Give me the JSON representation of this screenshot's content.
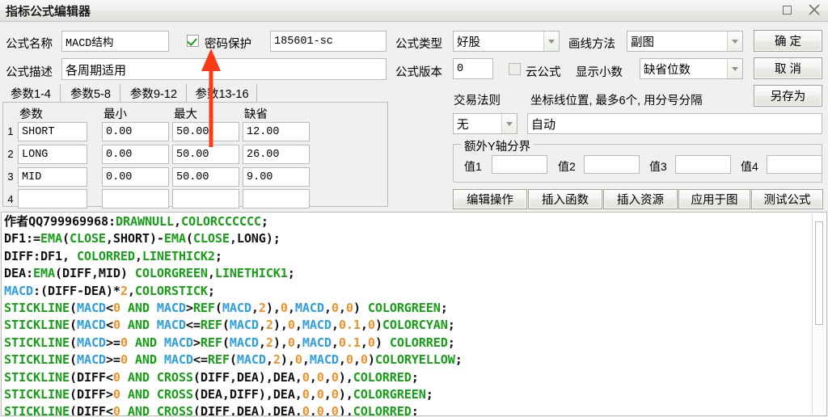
{
  "window": {
    "title": "指标公式编辑器",
    "maximize_icon": "maximize-icon",
    "close_icon": "close-icon"
  },
  "form": {
    "name_label": "公式名称",
    "name_value": "MACD结构",
    "password_protect_label": "密码保护",
    "password_protect_checked": true,
    "password_value": "185601-sc",
    "desc_label": "公式描述",
    "desc_value": "各周期适用",
    "type_label": "公式类型",
    "type_value": "好股",
    "draw_method_label": "画线方法",
    "draw_method_value": "副图",
    "version_label": "公式版本",
    "version_value": "0",
    "cloud_label": "云公式",
    "cloud_checked": false,
    "decimals_label": "显示小数",
    "decimals_value": "缺省位数"
  },
  "tabs": [
    {
      "label": "参数1-4",
      "active": true
    },
    {
      "label": "参数5-8",
      "active": false
    },
    {
      "label": "参数9-12",
      "active": false
    },
    {
      "label": "参数13-16",
      "active": false
    }
  ],
  "param_table": {
    "headers": [
      "参数",
      "最小",
      "最大",
      "缺省"
    ],
    "rows": [
      {
        "num": "1",
        "name": "SHORT",
        "min": "0.00",
        "max": "50.00",
        "default": "12.00"
      },
      {
        "num": "2",
        "name": "LONG",
        "min": "0.00",
        "max": "50.00",
        "default": "26.00"
      },
      {
        "num": "3",
        "name": "MID",
        "min": "0.00",
        "max": "50.00",
        "default": "9.00"
      },
      {
        "num": "4",
        "name": "",
        "min": "",
        "max": "",
        "default": ""
      }
    ]
  },
  "trade_rule": {
    "label": "交易法则",
    "value": "无"
  },
  "axis_line": {
    "label": "坐标线位置, 最多6个, 用分号分隔",
    "value": "自动"
  },
  "extra_y": {
    "title": "额外Y轴分界",
    "fields": [
      {
        "label": "值1",
        "value": ""
      },
      {
        "label": "值2",
        "value": ""
      },
      {
        "label": "值3",
        "value": ""
      },
      {
        "label": "值4",
        "value": ""
      }
    ]
  },
  "action_buttons": [
    {
      "label": "编辑操作"
    },
    {
      "label": "插入函数"
    },
    {
      "label": "插入资源"
    },
    {
      "label": "应用于图"
    },
    {
      "label": "测试公式"
    }
  ],
  "dialog_buttons": {
    "ok": "确  定",
    "cancel": "取  消",
    "save_as": "另存为"
  },
  "code": {
    "lines": [
      [
        {
          "t": "作者QQ799969968:",
          "c": "k"
        },
        {
          "t": "DRAWNULL",
          "c": "g"
        },
        {
          "t": ",",
          "c": "k"
        },
        {
          "t": "COLORCCCCCC",
          "c": "g"
        },
        {
          "t": ";",
          "c": "k"
        }
      ],
      [
        {
          "t": "DF1:=",
          "c": "k"
        },
        {
          "t": "EMA",
          "c": "g"
        },
        {
          "t": "(",
          "c": "k"
        },
        {
          "t": "CLOSE",
          "c": "g"
        },
        {
          "t": ",SHORT)-",
          "c": "k"
        },
        {
          "t": "EMA",
          "c": "g"
        },
        {
          "t": "(",
          "c": "k"
        },
        {
          "t": "CLOSE",
          "c": "g"
        },
        {
          "t": ",LONG);",
          "c": "k"
        }
      ],
      [
        {
          "t": "DIFF:DF1, ",
          "c": "k"
        },
        {
          "t": "COLORRED",
          "c": "g"
        },
        {
          "t": ",",
          "c": "k"
        },
        {
          "t": "LINETHICK2",
          "c": "g"
        },
        {
          "t": ";",
          "c": "k"
        }
      ],
      [
        {
          "t": "DEA:",
          "c": "k"
        },
        {
          "t": "EMA",
          "c": "g"
        },
        {
          "t": "(DIFF,MID) ",
          "c": "k"
        },
        {
          "t": "COLORGREEN",
          "c": "g"
        },
        {
          "t": ",",
          "c": "k"
        },
        {
          "t": "LINETHICK1",
          "c": "g"
        },
        {
          "t": ";",
          "c": "k"
        }
      ],
      [
        {
          "t": "MACD",
          "c": "b"
        },
        {
          "t": ":(DIFF-DEA)*",
          "c": "k"
        },
        {
          "t": "2",
          "c": "o"
        },
        {
          "t": ",",
          "c": "k"
        },
        {
          "t": "COLORSTICK",
          "c": "g"
        },
        {
          "t": ";",
          "c": "k"
        }
      ],
      [
        {
          "t": "STICKLINE",
          "c": "g"
        },
        {
          "t": "(",
          "c": "k"
        },
        {
          "t": "MACD",
          "c": "b"
        },
        {
          "t": "<",
          "c": "k"
        },
        {
          "t": "0",
          "c": "o"
        },
        {
          "t": " AND ",
          "c": "g"
        },
        {
          "t": "MACD",
          "c": "b"
        },
        {
          "t": ">",
          "c": "k"
        },
        {
          "t": "REF",
          "c": "g"
        },
        {
          "t": "(",
          "c": "k"
        },
        {
          "t": "MACD",
          "c": "b"
        },
        {
          "t": ",",
          "c": "k"
        },
        {
          "t": "2",
          "c": "o"
        },
        {
          "t": "),",
          "c": "k"
        },
        {
          "t": "0",
          "c": "o"
        },
        {
          "t": ",",
          "c": "k"
        },
        {
          "t": "MACD",
          "c": "b"
        },
        {
          "t": ",",
          "c": "k"
        },
        {
          "t": "0",
          "c": "o"
        },
        {
          "t": ",",
          "c": "k"
        },
        {
          "t": "0",
          "c": "o"
        },
        {
          "t": ") ",
          "c": "k"
        },
        {
          "t": "COLORGREEN",
          "c": "g"
        },
        {
          "t": ";",
          "c": "k"
        }
      ],
      [
        {
          "t": "STICKLINE",
          "c": "g"
        },
        {
          "t": "(",
          "c": "k"
        },
        {
          "t": "MACD",
          "c": "b"
        },
        {
          "t": "<",
          "c": "k"
        },
        {
          "t": "0",
          "c": "o"
        },
        {
          "t": " AND ",
          "c": "g"
        },
        {
          "t": "MACD",
          "c": "b"
        },
        {
          "t": "<=",
          "c": "k"
        },
        {
          "t": "REF",
          "c": "g"
        },
        {
          "t": "(",
          "c": "k"
        },
        {
          "t": "MACD",
          "c": "b"
        },
        {
          "t": ",",
          "c": "k"
        },
        {
          "t": "2",
          "c": "o"
        },
        {
          "t": "),",
          "c": "k"
        },
        {
          "t": "0",
          "c": "o"
        },
        {
          "t": ",",
          "c": "k"
        },
        {
          "t": "MACD",
          "c": "b"
        },
        {
          "t": ",",
          "c": "k"
        },
        {
          "t": "0.1",
          "c": "o"
        },
        {
          "t": ",",
          "c": "k"
        },
        {
          "t": "0",
          "c": "o"
        },
        {
          "t": ")",
          "c": "k"
        },
        {
          "t": "COLORCYAN",
          "c": "g"
        },
        {
          "t": ";",
          "c": "k"
        }
      ],
      [
        {
          "t": "STICKLINE",
          "c": "g"
        },
        {
          "t": "(",
          "c": "k"
        },
        {
          "t": "MACD",
          "c": "b"
        },
        {
          "t": ">=",
          "c": "k"
        },
        {
          "t": "0",
          "c": "o"
        },
        {
          "t": " AND ",
          "c": "g"
        },
        {
          "t": "MACD",
          "c": "b"
        },
        {
          "t": ">",
          "c": "k"
        },
        {
          "t": "REF",
          "c": "g"
        },
        {
          "t": "(",
          "c": "k"
        },
        {
          "t": "MACD",
          "c": "b"
        },
        {
          "t": ",",
          "c": "k"
        },
        {
          "t": "2",
          "c": "o"
        },
        {
          "t": "),",
          "c": "k"
        },
        {
          "t": "0",
          "c": "o"
        },
        {
          "t": ",",
          "c": "k"
        },
        {
          "t": "MACD",
          "c": "b"
        },
        {
          "t": ",",
          "c": "k"
        },
        {
          "t": "0.1",
          "c": "o"
        },
        {
          "t": ",",
          "c": "k"
        },
        {
          "t": "0",
          "c": "o"
        },
        {
          "t": ") ",
          "c": "k"
        },
        {
          "t": "COLORRED",
          "c": "g"
        },
        {
          "t": ";",
          "c": "k"
        }
      ],
      [
        {
          "t": "STICKLINE",
          "c": "g"
        },
        {
          "t": "(",
          "c": "k"
        },
        {
          "t": "MACD",
          "c": "b"
        },
        {
          "t": ">=",
          "c": "k"
        },
        {
          "t": "0",
          "c": "o"
        },
        {
          "t": " AND ",
          "c": "g"
        },
        {
          "t": "MACD",
          "c": "b"
        },
        {
          "t": "<=",
          "c": "k"
        },
        {
          "t": "REF",
          "c": "g"
        },
        {
          "t": "(",
          "c": "k"
        },
        {
          "t": "MACD",
          "c": "b"
        },
        {
          "t": ",",
          "c": "k"
        },
        {
          "t": "2",
          "c": "o"
        },
        {
          "t": "),",
          "c": "k"
        },
        {
          "t": "0",
          "c": "o"
        },
        {
          "t": ",",
          "c": "k"
        },
        {
          "t": "MACD",
          "c": "b"
        },
        {
          "t": ",",
          "c": "k"
        },
        {
          "t": "0",
          "c": "o"
        },
        {
          "t": ",",
          "c": "k"
        },
        {
          "t": "0",
          "c": "o"
        },
        {
          "t": ")",
          "c": "k"
        },
        {
          "t": "COLORYELLOW",
          "c": "g"
        },
        {
          "t": ";",
          "c": "k"
        }
      ],
      [
        {
          "t": "STICKLINE",
          "c": "g"
        },
        {
          "t": "(DIFF<",
          "c": "k"
        },
        {
          "t": "0",
          "c": "o"
        },
        {
          "t": " AND ",
          "c": "g"
        },
        {
          "t": "CROSS",
          "c": "g"
        },
        {
          "t": "(DIFF,DEA),DEA,",
          "c": "k"
        },
        {
          "t": "0",
          "c": "o"
        },
        {
          "t": ",",
          "c": "k"
        },
        {
          "t": "0",
          "c": "o"
        },
        {
          "t": ",",
          "c": "k"
        },
        {
          "t": "0",
          "c": "o"
        },
        {
          "t": "),",
          "c": "k"
        },
        {
          "t": "COLORRED",
          "c": "g"
        },
        {
          "t": ";",
          "c": "k"
        }
      ],
      [
        {
          "t": "STICKLINE",
          "c": "g"
        },
        {
          "t": "(DIFF>",
          "c": "k"
        },
        {
          "t": "0",
          "c": "o"
        },
        {
          "t": " AND ",
          "c": "g"
        },
        {
          "t": "CROSS",
          "c": "g"
        },
        {
          "t": "(DEA,DIFF),DEA,",
          "c": "k"
        },
        {
          "t": "0",
          "c": "o"
        },
        {
          "t": ",",
          "c": "k"
        },
        {
          "t": "0",
          "c": "o"
        },
        {
          "t": ",",
          "c": "k"
        },
        {
          "t": "0",
          "c": "o"
        },
        {
          "t": "),",
          "c": "k"
        },
        {
          "t": "COLORGREEN",
          "c": "g"
        },
        {
          "t": ";",
          "c": "k"
        }
      ],
      [
        {
          "t": "STICKLINE",
          "c": "g"
        },
        {
          "t": "(DIFF<",
          "c": "k"
        },
        {
          "t": "0",
          "c": "o"
        },
        {
          "t": " AND ",
          "c": "g"
        },
        {
          "t": "CROSS",
          "c": "g"
        },
        {
          "t": "(DIFF,DEA),DEA,",
          "c": "k"
        },
        {
          "t": "0",
          "c": "o"
        },
        {
          "t": ",",
          "c": "k"
        },
        {
          "t": "0",
          "c": "o"
        },
        {
          "t": ",",
          "c": "k"
        },
        {
          "t": "0",
          "c": "o"
        },
        {
          "t": "),",
          "c": "k"
        },
        {
          "t": "COLORRED",
          "c": "g"
        },
        {
          "t": ";",
          "c": "k"
        }
      ]
    ]
  },
  "annotation": {
    "arrow_color": "#fb3b18"
  }
}
